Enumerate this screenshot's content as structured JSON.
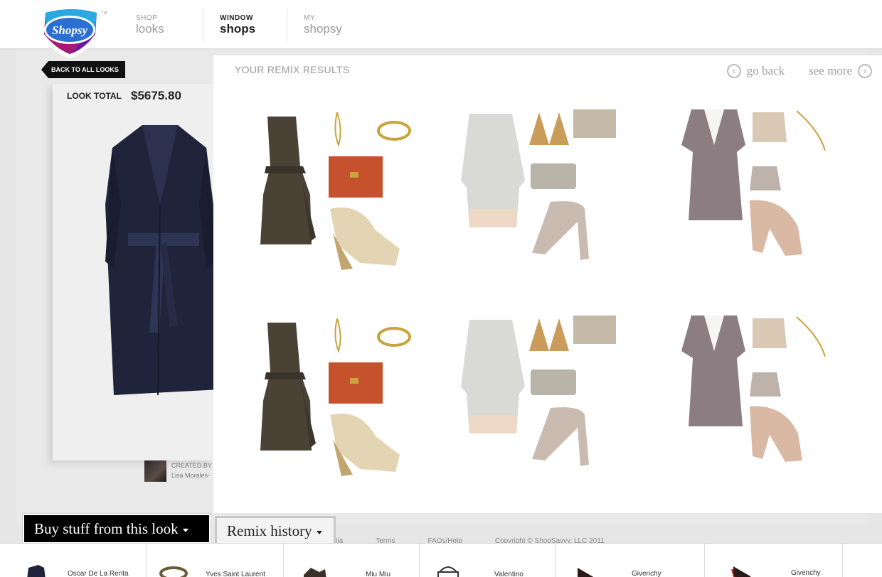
{
  "brand": {
    "name": "Shopsy",
    "trademark": "TM"
  },
  "nav": [
    {
      "small": "SHOP",
      "big": "looks",
      "active": false
    },
    {
      "small": "WINDOW",
      "big": "shops",
      "active": true
    },
    {
      "small": "MY",
      "big": "shopsy",
      "active": false
    }
  ],
  "look": {
    "back_label": "BACK TO ALL LOOKS",
    "total_label": "LOOK TOTAL",
    "total_value": "$5675.80",
    "creator_label": "CREATED BY",
    "creator_name": "Lisa Morales-"
  },
  "remix": {
    "title": "YOUR REMIX RESULTS",
    "go_back": "go back",
    "see_more": "see more"
  },
  "tabs": {
    "buy": "Buy stuff from this look",
    "history": "Remix history"
  },
  "footer_links": [
    "ilia",
    "Terms",
    "FAQs/Help",
    "Copyright © ShopSavvy, LLC 2011"
  ],
  "strip": [
    {
      "label": "Oscar De La Renta"
    },
    {
      "label": "Yves Saint Laurent"
    },
    {
      "label": "Miu Miu"
    },
    {
      "label": "Valentino"
    },
    {
      "label": "Givenchy"
    },
    {
      "label": "Givenchy"
    }
  ]
}
